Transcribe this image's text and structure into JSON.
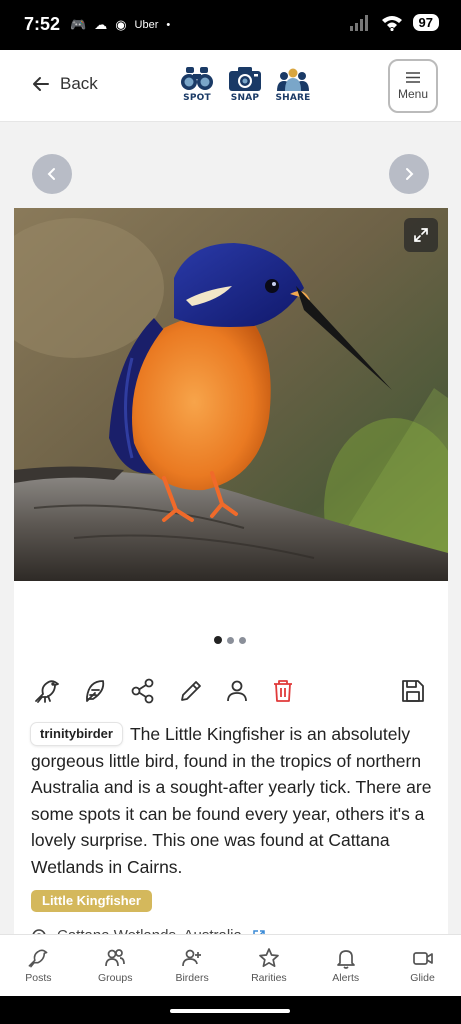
{
  "status_bar": {
    "time": "7:52",
    "apps": [
      "Uber"
    ],
    "battery": "97"
  },
  "header": {
    "back_label": "Back",
    "logos": [
      {
        "label": "SPOT",
        "icon": "binoculars-icon"
      },
      {
        "label": "SNAP",
        "icon": "camera-icon"
      },
      {
        "label": "SHARE",
        "icon": "people-icon"
      }
    ],
    "menu_label": "Menu"
  },
  "carousel": {
    "current_index": 1,
    "total": 3
  },
  "post": {
    "username": "trinitybirder",
    "caption": "The Little Kingfisher is an absolutely gorgeous little bird, found in the tropics of northern Australia and is a sought-after yearly tick. There are some spots it can be found every year, others it's a lovely surprise. This one was found at Cattana Wetlands in Cairns.",
    "species_tag": "Little Kingfisher",
    "location": "Cattana Wetlands, Australia",
    "actions": [
      "bird-icon",
      "feather-icon",
      "share-icon",
      "edit-icon",
      "user-icon",
      "trash-icon",
      "save-icon"
    ]
  },
  "bottom_nav": {
    "items": [
      {
        "label": "Posts",
        "icon": "bird-icon"
      },
      {
        "label": "Groups",
        "icon": "group-icon"
      },
      {
        "label": "Birders",
        "icon": "add-user-icon"
      },
      {
        "label": "Rarities",
        "icon": "star-icon"
      },
      {
        "label": "Alerts",
        "icon": "bell-icon"
      },
      {
        "label": "Glide",
        "icon": "video-icon"
      }
    ]
  },
  "colors": {
    "species_tag": "#d4b85c",
    "delete": "#e03a3a",
    "logo_text": "#1a3a66"
  }
}
